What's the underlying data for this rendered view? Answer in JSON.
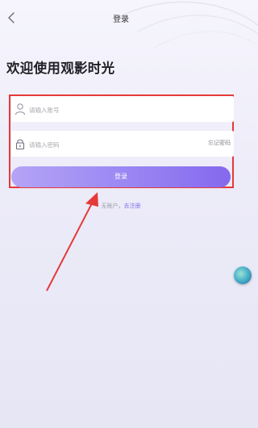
{
  "header": {
    "title": "登录",
    "back_icon": "chevron-left-icon"
  },
  "welcome_text": "欢迎使用观影时光",
  "form": {
    "account": {
      "placeholder": "请输入账号",
      "icon": "user-icon"
    },
    "password": {
      "placeholder": "请输入密码",
      "icon": "lock-icon",
      "forgot_label": "忘记密码"
    },
    "login_label": "登录"
  },
  "register": {
    "prefix": "无账户，",
    "link": "去注册"
  },
  "colors": {
    "accent": "#8469ee",
    "highlight_box": "#e53a3a",
    "annotation_arrow": "#e53a3a"
  }
}
